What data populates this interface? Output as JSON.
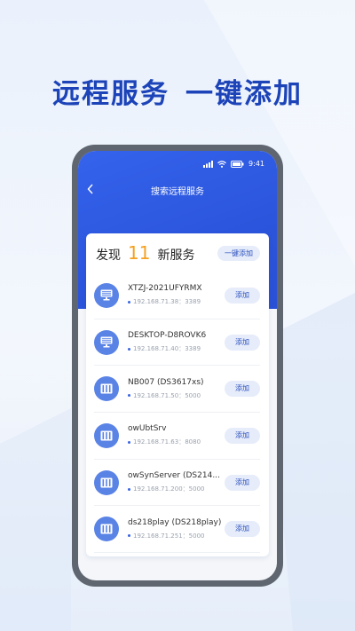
{
  "headline": {
    "part1": "远程服务",
    "part2": "一键添加"
  },
  "status_bar": {
    "time": "9:41"
  },
  "nav": {
    "title": "搜索远程服务"
  },
  "summary": {
    "prefix": "发现",
    "count": "11",
    "suffix": "新服务",
    "one_key_label": "一键添加"
  },
  "devices": [
    {
      "name": "XTZJ-2021UFYRMX",
      "address": "192.168.71.38：3389",
      "icon": "desktop-icon",
      "add_label": "添加"
    },
    {
      "name": "DESKTOP-D8ROVK6",
      "address": "192.168.71.40：3389",
      "icon": "desktop-icon",
      "add_label": "添加"
    },
    {
      "name": "NB007 (DS3617xs)",
      "address": "192.168.71.50：5000",
      "icon": "nas-icon",
      "add_label": "添加"
    },
    {
      "name": "owUbtSrv",
      "address": "192.168.71.63：8080",
      "icon": "nas-icon",
      "add_label": "添加"
    },
    {
      "name": "owSynServer (DS214...",
      "address": "192.168.71.200：5000",
      "icon": "nas-icon",
      "add_label": "添加"
    },
    {
      "name": "ds218play (DS218play)",
      "address": "192.168.71.251：5000",
      "icon": "nas-icon",
      "add_label": "添加"
    }
  ],
  "colors": {
    "brand_blue": "#2b55dc",
    "headline_blue": "#1c43b8",
    "count_orange": "#f5a020",
    "icon_blue": "#5a83e6"
  }
}
